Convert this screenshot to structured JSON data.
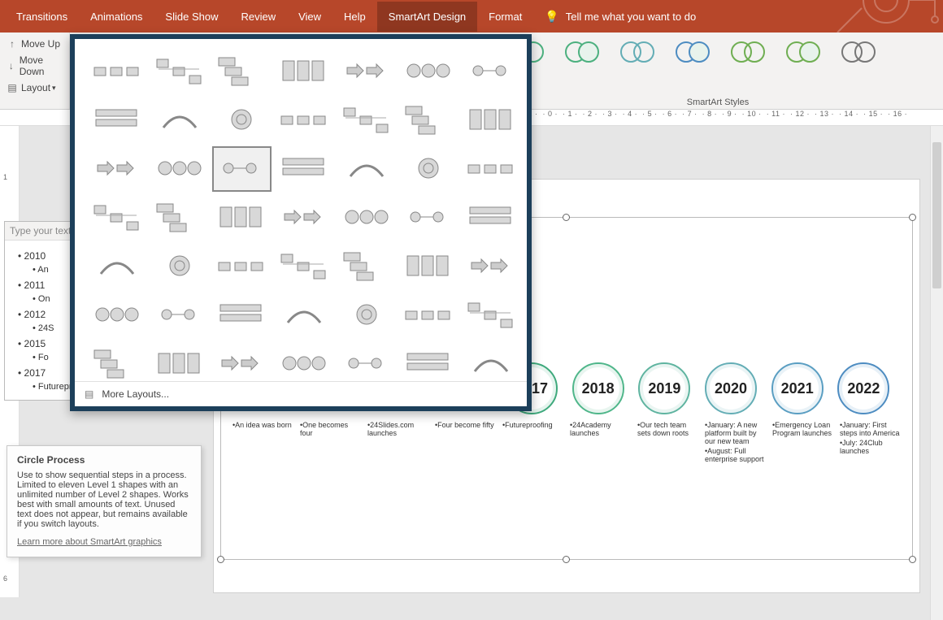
{
  "ribbon": {
    "tabs": [
      "Transitions",
      "Animations",
      "Slide Show",
      "Review",
      "View",
      "Help"
    ],
    "active_tab": "SmartArt Design",
    "format_tab": "Format",
    "tell_me": "Tell me what you want to do",
    "move_up": "Move Up",
    "move_down": "Move Down",
    "layout": "Layout",
    "styles_label": "SmartArt Styles"
  },
  "ruler": {
    "ticks": [
      "1",
      "0",
      "1",
      "2",
      "3",
      "4",
      "5",
      "6",
      "7",
      "8",
      "9",
      "10",
      "11",
      "12",
      "13",
      "14",
      "15",
      "16"
    ]
  },
  "text_pane": {
    "header": "Type your text h",
    "items": [
      {
        "year": "2010",
        "sub": "An"
      },
      {
        "year": "2011",
        "sub": "On"
      },
      {
        "year": "2012",
        "sub": "24S"
      },
      {
        "year": "2015",
        "sub": "Fo"
      },
      {
        "year": "2017",
        "sub": "Futureproofing"
      }
    ]
  },
  "tooltip": {
    "title": "Circle Process",
    "body": "Use to show sequential steps in a process. Limited to eleven Level 1 shapes with an unlimited number of Level 2 shapes. Works best with small amounts of text. Unused text does not appear, but remains available if you switch layouts.",
    "link": "Learn more about SmartArt graphics"
  },
  "gallery": {
    "more_layouts": "More Layouts..."
  },
  "timeline": [
    {
      "year": "2017",
      "color": "#3ea97c",
      "cap": [
        "Futureproofing"
      ]
    },
    {
      "year": "2018",
      "color": "#4fb68a",
      "cap": [
        "24Academy launches"
      ]
    },
    {
      "year": "2019",
      "color": "#5fb4a0",
      "cap": [
        "Our tech team sets down roots"
      ]
    },
    {
      "year": "2020",
      "color": "#63adb5",
      "cap": [
        "January: A new platform built by our new team",
        "August: Full enterprise support"
      ]
    },
    {
      "year": "2021",
      "color": "#5a9ec2",
      "cap": [
        "Emergency Loan Program launches"
      ]
    },
    {
      "year": "2022",
      "color": "#4d8cc1",
      "cap": [
        "January: First steps into America",
        "July: 24Club launches"
      ]
    }
  ],
  "captions_left": [
    {
      "cap": [
        "An idea was born"
      ]
    },
    {
      "cap": [
        "One becomes four"
      ]
    },
    {
      "cap": [
        "24Slides.com launches"
      ]
    },
    {
      "cap": [
        "Four become fifty"
      ]
    }
  ],
  "style_colors": [
    "#4cb07f",
    "#4cb07f",
    "#63adb5",
    "#4d8cc1",
    "#6fae52",
    "#6fae52",
    "#777"
  ]
}
